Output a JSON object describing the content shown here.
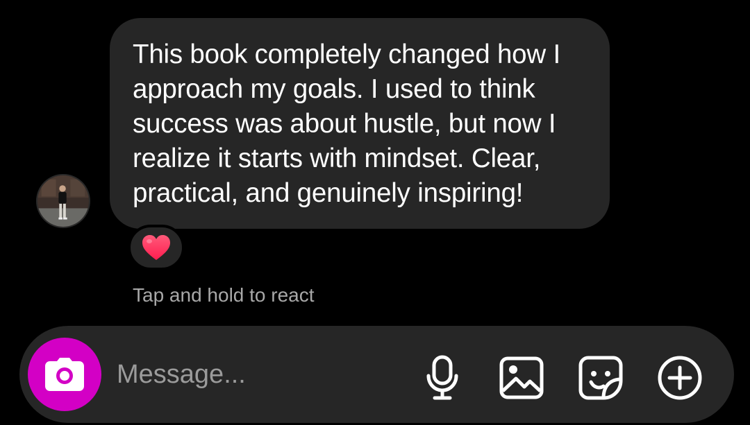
{
  "conversation": {
    "message": {
      "text": "This book completely changed how I approach my goals. I used to think success was about hustle, but now I realize it starts with mindset. Clear, practical, and genuinely inspiring!",
      "reaction": "heart"
    },
    "hint": "Tap and hold to react"
  },
  "composer": {
    "placeholder": "Message...",
    "camera_color": "#d300c5",
    "icons": [
      "camera-icon",
      "microphone-icon",
      "gallery-icon",
      "sticker-icon",
      "plus-circle-icon"
    ]
  }
}
